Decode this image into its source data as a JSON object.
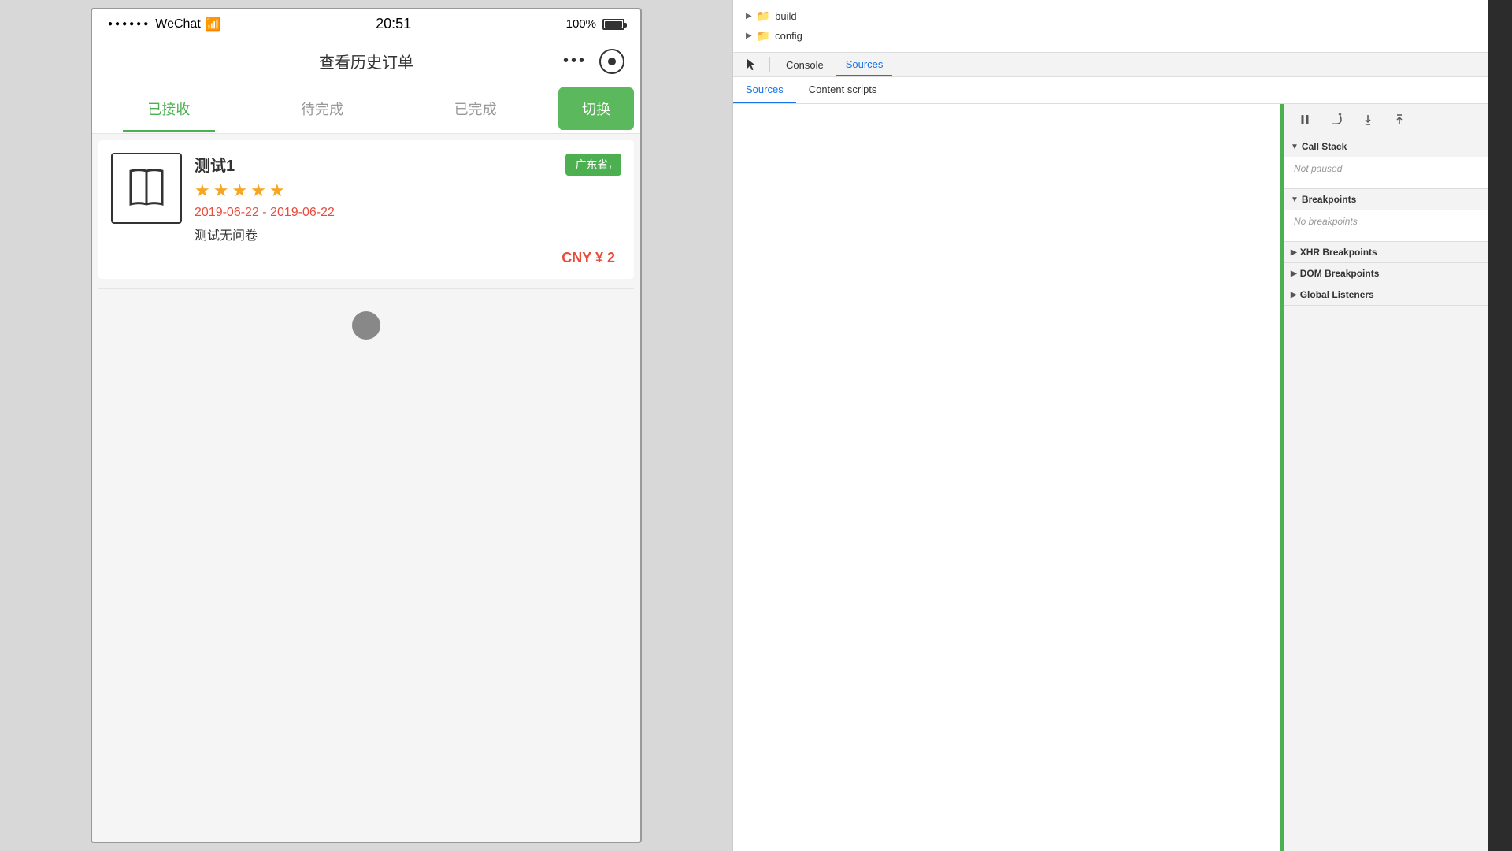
{
  "phone": {
    "status_bar": {
      "signal": "●●●●●●",
      "carrier": "WeChat",
      "wifi": "WiFi",
      "time": "20:51",
      "battery_percent": "100%"
    },
    "header": {
      "title": "查看历史订单",
      "dots": "●●●"
    },
    "tabs": [
      {
        "label": "已接收",
        "active": true
      },
      {
        "label": "待完成",
        "active": false
      },
      {
        "label": "已完成",
        "active": false
      },
      {
        "label": "切换",
        "type": "switch"
      }
    ],
    "order": {
      "name": "测试1",
      "region": "广东省،",
      "stars": 5,
      "date_range": "2019-06-22 - 2019-06-22",
      "questionnaire": "测试无问卷",
      "price": "CNY ¥ 2"
    }
  },
  "devtools": {
    "file_tree": [
      {
        "label": "build",
        "type": "folder",
        "expanded": false
      },
      {
        "label": "config",
        "type": "folder",
        "expanded": false
      }
    ],
    "toolbar": {
      "cursor_icon": "⬡",
      "tabs": [
        {
          "label": "Console",
          "active": false
        },
        {
          "label": "Sources",
          "active": true
        }
      ]
    },
    "sources_tabs": [
      {
        "label": "Sources",
        "active": true
      },
      {
        "label": "Content scripts",
        "active": false
      }
    ],
    "debugger": {
      "toolbar_buttons": [
        {
          "name": "pause",
          "symbol": "⏸"
        },
        {
          "name": "step-over",
          "symbol": "↻"
        },
        {
          "name": "step-into",
          "symbol": "↓"
        },
        {
          "name": "step-out",
          "symbol": "↑"
        }
      ],
      "sections": [
        {
          "id": "call-stack",
          "label": "Call Stack",
          "expanded": true,
          "content": "Not paused"
        },
        {
          "id": "breakpoints",
          "label": "Breakpoints",
          "expanded": true,
          "content": "No breakpoints"
        },
        {
          "id": "xhr-breakpoints",
          "label": "XHR Breakpoints",
          "expanded": false,
          "content": ""
        },
        {
          "id": "dom-breakpoints",
          "label": "DOM Breakpoints",
          "expanded": false,
          "content": ""
        },
        {
          "id": "global-listeners",
          "label": "Global Listeners",
          "expanded": false,
          "content": ""
        }
      ]
    }
  }
}
